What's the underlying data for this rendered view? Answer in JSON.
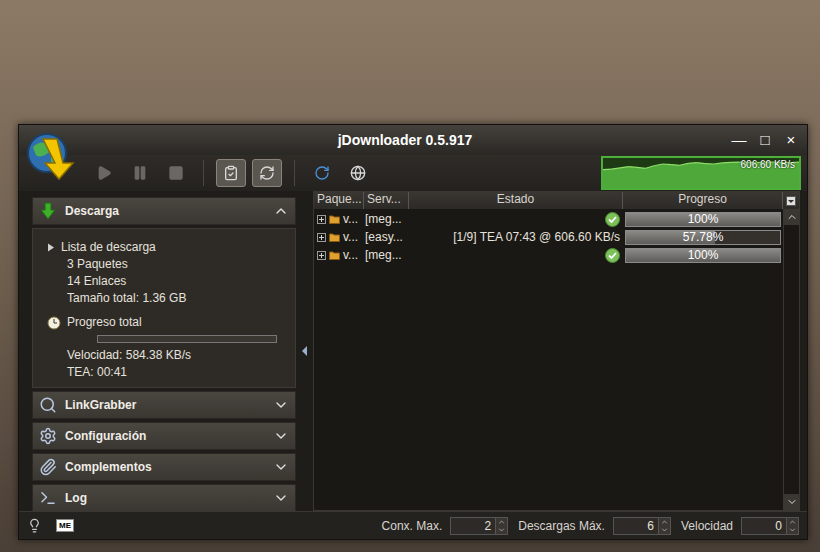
{
  "window": {
    "title": "jDownloader 0.5.917",
    "controls": [
      "—",
      "□",
      "×"
    ]
  },
  "toolbar": {
    "buttons": [
      {
        "disabled": true,
        "selected": false
      },
      {
        "disabled": true,
        "selected": false
      },
      {
        "disabled": true,
        "selected": false
      },
      {
        "disabled": false,
        "selected": true
      },
      {
        "disabled": false,
        "selected": true
      },
      {
        "disabled": false,
        "selected": false
      },
      {
        "disabled": false,
        "selected": false
      }
    ]
  },
  "speed_graph": {
    "reading": "606.60 KB/s",
    "max": 700,
    "values": [
      430,
      440,
      470,
      500,
      480,
      460,
      520,
      560,
      545,
      530,
      575,
      590,
      570,
      560,
      585,
      600,
      606,
      598,
      590,
      604,
      606,
      600,
      595,
      606
    ]
  },
  "sidebar": {
    "sections": [
      {
        "label": "Descarga",
        "expanded": true
      },
      {
        "label": "LinkGrabber",
        "expanded": false
      },
      {
        "label": "Configuración",
        "expanded": false
      },
      {
        "label": "Complementos",
        "expanded": false
      },
      {
        "label": "Log",
        "expanded": false
      }
    ],
    "download_panel": {
      "list_label": "Lista de descarga",
      "lines": [
        "3 Paquetes",
        "14 Enlaces",
        "Tamaño total: 1.36 GB"
      ],
      "progress_label": "Progreso total",
      "progress_level": 0,
      "stats": [
        "Velocidad: 584.38 KB/s",
        "TEA: 00:41"
      ]
    }
  },
  "table": {
    "columns": [
      "Paque...",
      "Serv...",
      "Estado",
      "Progreso"
    ],
    "rows": [
      {
        "package": "v...",
        "host": "[meg...",
        "status": "",
        "done": true,
        "expanded": false,
        "progress": "100%",
        "level": 1
      },
      {
        "package": "v...",
        "host": "[easy...",
        "status": "[1/9] TEA 07:43 @ 606.60 KB/s",
        "done": false,
        "expanded": false,
        "progress": "57.78%",
        "level": 0.5778
      },
      {
        "package": "v...",
        "host": "[meg...",
        "status": "",
        "done": true,
        "expanded": false,
        "progress": "100%",
        "level": 1
      }
    ]
  },
  "status_bar": {
    "badge": "ME",
    "fields": [
      {
        "label": "Conx. Max.",
        "value": "2"
      },
      {
        "label": "Descargas Máx.",
        "value": "6"
      },
      {
        "label": "Velocidad",
        "value": "0"
      }
    ]
  }
}
